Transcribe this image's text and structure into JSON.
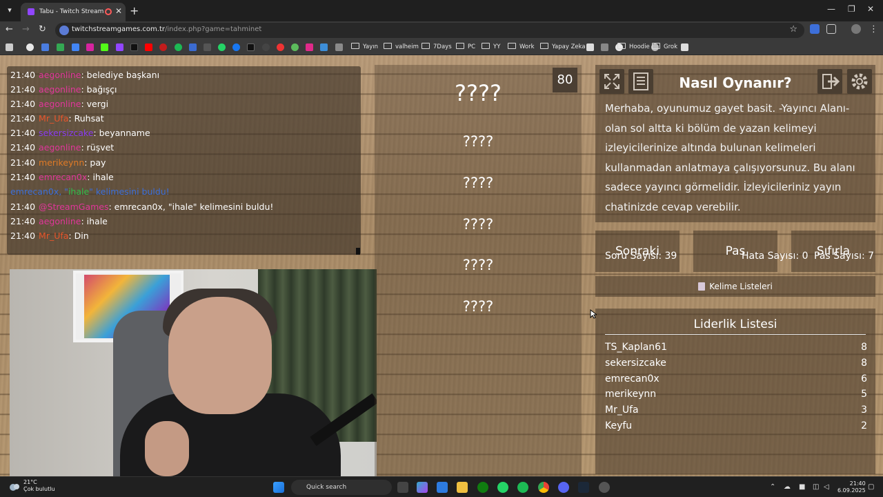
{
  "browser": {
    "tab_title": "Tabu - Twitch Stream Games",
    "url_host": "twitchstreamgames.com.tr",
    "url_path": "/index.php?game=tahminet",
    "bookmarks": [
      "Yayın",
      "valheim",
      "7Days",
      "PC",
      "YY",
      "Work",
      "Yapay Zeka",
      "Hoodie",
      "Grok"
    ]
  },
  "chat": {
    "lines": [
      {
        "time": "21:40",
        "user": "aegonline",
        "user_color": "#e0369a",
        "text": ": belediye başkanı"
      },
      {
        "time": "21:40",
        "user": "aegonline",
        "user_color": "#e0369a",
        "text": ": bağışçı"
      },
      {
        "time": "21:40",
        "user": "aegonline",
        "user_color": "#e0369a",
        "text": ": vergi"
      },
      {
        "time": "21:40",
        "user": "Mr_Ufa",
        "user_color": "#e8552b",
        "text": ": Ruhsat"
      },
      {
        "time": "21:40",
        "user": "sekersizcake",
        "user_color": "#8a3cf0",
        "text": ": beyanname"
      },
      {
        "time": "21:40",
        "user": "aegonline",
        "user_color": "#e0369a",
        "text": ": rüşvet"
      },
      {
        "time": "21:40",
        "user": "merikeynn",
        "user_color": "#e07a26",
        "text": ": pay"
      },
      {
        "time": "21:40",
        "user": "emrecan0x",
        "user_color": "#e0369a",
        "text": ": ihale"
      },
      {
        "time": "21:40",
        "user": "@StreamGames",
        "user_color": "#e0369a",
        "text": ": emrecan0x, \"ihale\" kelimesini buldu!"
      },
      {
        "time": "21:40",
        "user": "aegonline",
        "user_color": "#e0369a",
        "text": ": ihale"
      },
      {
        "time": "21:40",
        "user": "Mr_Ufa",
        "user_color": "#e8552b",
        "text": ": Din"
      }
    ],
    "system_pre": "emrecan0x, \"",
    "system_word": "ihale",
    "system_post": "\" kelimesini buldu!"
  },
  "game": {
    "score": "80",
    "main_word": "????",
    "forbidden_words": [
      "????",
      "????",
      "????",
      "????",
      "????"
    ]
  },
  "howto": {
    "title": "Nasıl Oynanır?",
    "text": "Merhaba, oyunumuz gayet basit. -Yayıncı Alanı- olan sol altta ki bölüm de yazan kelimeyi izleyicilerinize altında bulunan kelimeleri kullanmadan anlatmaya çalışıyorsunuz. Bu alanı sadece yayıncı görmelidir. İzleyicileriniz yayın chatinizde cevap verebilir."
  },
  "buttons": {
    "next": "Sonraki",
    "pass": "Pas",
    "reset": "Sıfırla",
    "word_lists": "Kelime Listeleri"
  },
  "leaderboard": {
    "title": "Liderlik Listesi",
    "rows": [
      {
        "name": "TS_Kaplan61",
        "score": "8"
      },
      {
        "name": "sekersizcake",
        "score": "8"
      },
      {
        "name": "emrecan0x",
        "score": "6"
      },
      {
        "name": "merikeynn",
        "score": "5"
      },
      {
        "name": "Mr_Ufa",
        "score": "3"
      },
      {
        "name": "Keyfu",
        "score": "2"
      }
    ]
  },
  "stats": {
    "questions": "Soru Sayısı: 39",
    "errors": "Hata Sayısı: 0",
    "passes": "Pas Sayısı: 7"
  },
  "taskbar": {
    "temp": "21°C",
    "weather": "Çok bulutlu",
    "search_placeholder": "Quick search",
    "time": "21:40",
    "date": "6.09.2025"
  }
}
